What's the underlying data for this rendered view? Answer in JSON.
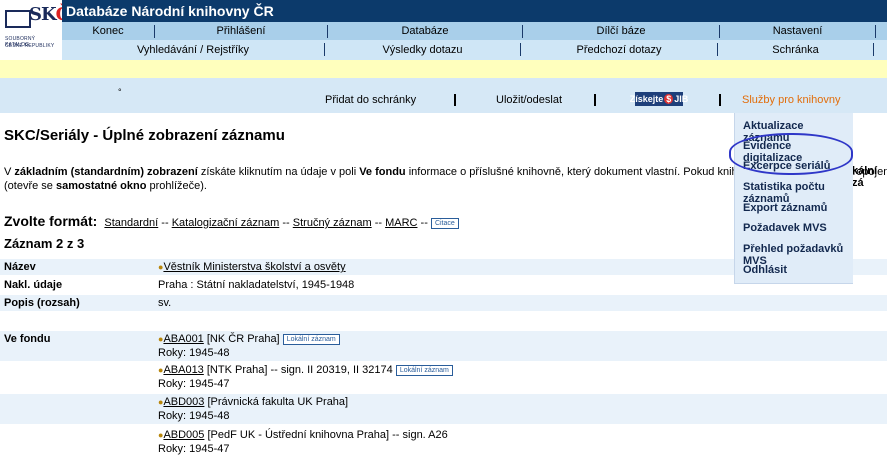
{
  "logo": {
    "mark_a": "SK",
    "mark_b": "ČR",
    "sub1": "SOUBORNÝ KATALOG",
    "sub2": "ČESKÉ REPUBLIKY"
  },
  "app_title": "Databáze Národní knihovny ČR",
  "nav1": [
    "Konec",
    "Přihlášení",
    "Databáze",
    "Dílčí báze",
    "Nastavení"
  ],
  "nav2": [
    "Vyhledávání / Rejstříky",
    "Výsledky dotazu",
    "Předchozí dotazy",
    "Schránka"
  ],
  "toolbar": {
    "dot": "°",
    "add": "Přidat do schránky",
    "save": "Uložit/odeslat",
    "jib_a": "Získejte",
    "jib_b": "$",
    "jib_c": "JIB",
    "services": "Služby pro knihovny"
  },
  "page_title": "SKC/Seriály - Úplné zobrazení záznamu",
  "info": {
    "p1": "V ",
    "b1": "základním (standardním) zobrazení",
    "p2": " získáte kliknutím na údaje v poli ",
    "b2": "Ve fondu",
    "p3": " informace o příslušné knihovně, který dokument vlastní. Pokud knihovna poskytla údaje k propojení do loka",
    "line2a": "(otevře se ",
    "line2b": "samostatné okno",
    "line2c": " prohlížeče).",
    "tail": "kální zá"
  },
  "format": {
    "label": "Zvolte formát:",
    "opts": [
      "Standardní",
      "Katalogizační záznam",
      "Stručný záznam",
      "MARC"
    ],
    "sep": "--",
    "citace": "Citace"
  },
  "record_count": "Záznam 2 z 3",
  "fields": [
    {
      "k": "Název",
      "v": "Věstník Ministerstva školství a osvěty"
    },
    {
      "k": "Nakl. údaje",
      "v": "Praha : Státní nakladatelství, 1945-1948"
    },
    {
      "k": "Popis (rozsah)",
      "v": "sv."
    }
  ],
  "holdings_label": "Ve fondu",
  "holdings": [
    {
      "code": "ABA001",
      "rest": " [NK ČR Praha]",
      "btn": "Lokální záznam",
      "years": "Roky: 1945-48"
    },
    {
      "code": "ABA013",
      "rest": " [NTK Praha] -- sign. II 20319, II 32174",
      "btn": "Lokální záznam",
      "years": "Roky: 1945-47"
    },
    {
      "code": "ABD003",
      "rest": " [Právnická fakulta UK Praha]",
      "btn": "",
      "years": "Roky: 1945-48"
    },
    {
      "code": "ABD005",
      "rest": " [PedF UK - Ústřední knihovna Praha] -- sign. A26",
      "btn": "",
      "years": "Roky: 1945-47"
    }
  ],
  "menu": [
    "Aktualizace záznamu",
    "Evidence digitalizace",
    "Excerpce seriálů",
    "Statistika počtu záznamů",
    "Export záznamů",
    "Požadavek MVS",
    "Přehled požadavků MVS",
    "Odhlásit"
  ],
  "colors": {
    "title_bar": "#0c3a6b",
    "nav1": "#a9cfea",
    "nav2": "#cfe6f6",
    "services": "#e26d0a",
    "circle": "#2f37c8"
  }
}
